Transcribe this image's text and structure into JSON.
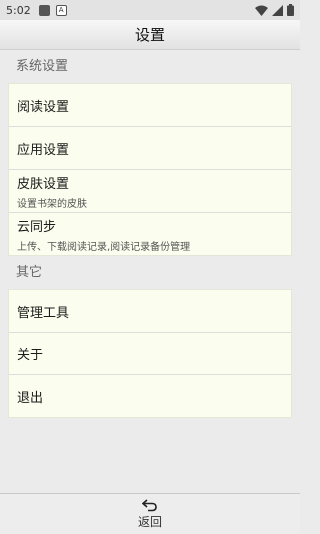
{
  "status_bar": {
    "time": "5:02",
    "small_icon_letter": "A"
  },
  "title_bar": {
    "title": "设置"
  },
  "sections": [
    {
      "header": "系统设置",
      "items": [
        {
          "label": "阅读设置",
          "sub": ""
        },
        {
          "label": "应用设置",
          "sub": ""
        },
        {
          "label": "皮肤设置",
          "sub": "设置书架的皮肤"
        },
        {
          "label": "云同步",
          "sub": "上传、下载阅读记录,阅读记录备份管理"
        }
      ]
    },
    {
      "header": "其它",
      "items": [
        {
          "label": "管理工具"
        },
        {
          "label": "关于"
        },
        {
          "label": "退出"
        }
      ]
    }
  ],
  "bottom_bar": {
    "back_label": "返回",
    "back_icon": "return-arrow-icon"
  }
}
